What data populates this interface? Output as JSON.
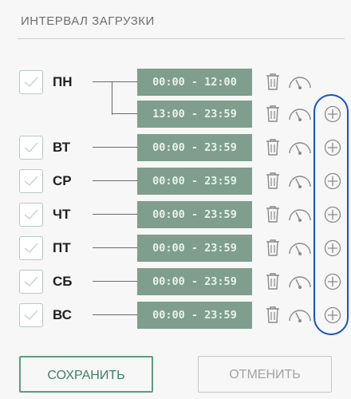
{
  "section_title": "ИНТЕРВАЛ ЗАГРУЗКИ",
  "days": [
    {
      "label": "ПН",
      "checked": true,
      "intervals": [
        "00:00 - 12:00",
        "13:00 - 23:59"
      ]
    },
    {
      "label": "ВТ",
      "checked": true,
      "intervals": [
        "00:00 - 23:59"
      ]
    },
    {
      "label": "СР",
      "checked": true,
      "intervals": [
        "00:00 - 23:59"
      ]
    },
    {
      "label": "ЧТ",
      "checked": true,
      "intervals": [
        "00:00 - 23:59"
      ]
    },
    {
      "label": "ПТ",
      "checked": true,
      "intervals": [
        "00:00 - 23:59"
      ]
    },
    {
      "label": "СБ",
      "checked": true,
      "intervals": [
        "00:00 - 23:59"
      ]
    },
    {
      "label": "ВС",
      "checked": true,
      "intervals": [
        "00:00 - 23:59"
      ]
    }
  ],
  "row_icons": [
    "trash-icon",
    "gauge-icon",
    "add-circle-icon"
  ],
  "buttons": {
    "save": "СОХРАНИТЬ",
    "cancel": "ОТМЕНИТЬ"
  },
  "colors": {
    "time_chip": "#7f9e8d",
    "time_text": "#e9f2ec",
    "save_accent": "#3f7e66",
    "highlight": "#1554c7"
  }
}
